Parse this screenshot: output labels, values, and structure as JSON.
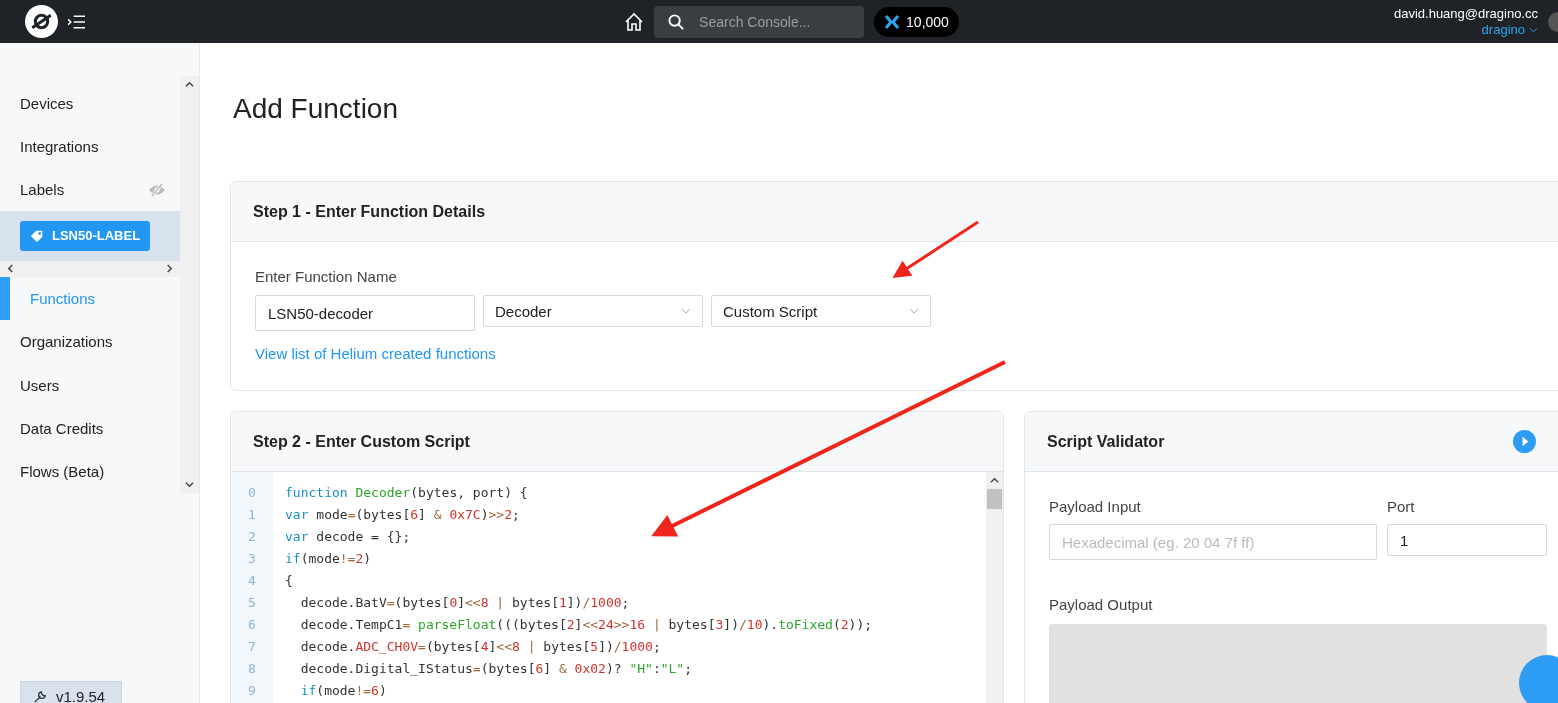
{
  "topbar": {
    "search": {
      "placeholder": "Search Console..."
    },
    "credits": "10,000",
    "user": {
      "email": "david.huang@dragino.cc",
      "org": "dragino"
    }
  },
  "sidebar": {
    "items": [
      {
        "kind": "nav",
        "label": "Devices",
        "selected": false
      },
      {
        "kind": "nav",
        "label": "Integrations",
        "selected": false
      },
      {
        "kind": "nav-hidden",
        "label": "Labels",
        "selected": false
      },
      {
        "kind": "chip",
        "label": "LSN50-LABEL",
        "selected": true
      },
      {
        "kind": "nav",
        "label": "Functions",
        "selected": true
      },
      {
        "kind": "nav",
        "label": "Organizations",
        "selected": false
      },
      {
        "kind": "nav",
        "label": "Users",
        "selected": false
      },
      {
        "kind": "nav",
        "label": "Data Credits",
        "selected": false
      },
      {
        "kind": "nav",
        "label": "Flows (Beta)",
        "selected": false
      }
    ],
    "version": "v1.9.54"
  },
  "page_title": "Add Function",
  "step1": {
    "title": "Step 1 - Enter Function Details",
    "field_label": "Enter Function Name",
    "name_value": "LSN50-decoder",
    "type_select": "Decoder",
    "format_select": "Custom Script",
    "link": "View list of Helium created functions"
  },
  "step2": {
    "title": "Step 2 - Enter Custom Script",
    "code_lines": [
      {
        "number": "0",
        "tokens": [
          {
            "kind": "kw",
            "text": "function"
          },
          {
            "kind": "fn",
            "text": " Decoder"
          },
          {
            "kind": "plain",
            "text": "(bytes, port) {"
          }
        ]
      },
      {
        "number": "1",
        "tokens": [
          {
            "kind": "kw",
            "text": "var"
          },
          {
            "kind": "plain",
            "text": " mode"
          },
          {
            "kind": "op",
            "text": "="
          },
          {
            "kind": "plain",
            "text": "(bytes["
          },
          {
            "kind": "num",
            "text": "6"
          },
          {
            "kind": "plain",
            "text": "] "
          },
          {
            "kind": "op",
            "text": "&"
          },
          {
            "kind": "num",
            "text": " 0x7C"
          },
          {
            "kind": "plain",
            "text": ")"
          },
          {
            "kind": "op",
            "text": ">>"
          },
          {
            "kind": "num",
            "text": "2"
          },
          {
            "kind": "plain",
            "text": ";"
          }
        ]
      },
      {
        "number": "2",
        "tokens": [
          {
            "kind": "kw",
            "text": "var"
          },
          {
            "kind": "plain",
            "text": " decode = {};"
          }
        ]
      },
      {
        "number": "3",
        "tokens": [
          {
            "kind": "kw",
            "text": "if"
          },
          {
            "kind": "plain",
            "text": "(mode"
          },
          {
            "kind": "op",
            "text": "!="
          },
          {
            "kind": "num",
            "text": "2"
          },
          {
            "kind": "plain",
            "text": ")"
          }
        ]
      },
      {
        "number": "4",
        "tokens": [
          {
            "kind": "plain",
            "text": "{"
          }
        ]
      },
      {
        "number": "5",
        "tokens": [
          {
            "kind": "plain",
            "text": "  decode.BatV"
          },
          {
            "kind": "op",
            "text": "="
          },
          {
            "kind": "plain",
            "text": "(bytes["
          },
          {
            "kind": "num",
            "text": "0"
          },
          {
            "kind": "plain",
            "text": "]"
          },
          {
            "kind": "op",
            "text": "<<"
          },
          {
            "kind": "num",
            "text": "8"
          },
          {
            "kind": "op",
            "text": " |"
          },
          {
            "kind": "plain",
            "text": " bytes["
          },
          {
            "kind": "num",
            "text": "1"
          },
          {
            "kind": "plain",
            "text": "])"
          },
          {
            "kind": "op",
            "text": "/"
          },
          {
            "kind": "num",
            "text": "1000"
          },
          {
            "kind": "plain",
            "text": ";"
          }
        ]
      },
      {
        "number": "6",
        "tokens": [
          {
            "kind": "plain",
            "text": "  decode.TempC1"
          },
          {
            "kind": "op",
            "text": "="
          },
          {
            "kind": "fn",
            "text": " parseFloat"
          },
          {
            "kind": "plain",
            "text": "(((bytes["
          },
          {
            "kind": "num",
            "text": "2"
          },
          {
            "kind": "plain",
            "text": "]"
          },
          {
            "kind": "op",
            "text": "<<"
          },
          {
            "kind": "num",
            "text": "24"
          },
          {
            "kind": "op",
            "text": ">>"
          },
          {
            "kind": "num",
            "text": "16"
          },
          {
            "kind": "op",
            "text": " |"
          },
          {
            "kind": "plain",
            "text": " bytes["
          },
          {
            "kind": "num",
            "text": "3"
          },
          {
            "kind": "plain",
            "text": "])"
          },
          {
            "kind": "op",
            "text": "/"
          },
          {
            "kind": "num",
            "text": "10"
          },
          {
            "kind": "plain",
            "text": ")."
          },
          {
            "kind": "fn",
            "text": "toFixed"
          },
          {
            "kind": "plain",
            "text": "("
          },
          {
            "kind": "num",
            "text": "2"
          },
          {
            "kind": "plain",
            "text": "));"
          }
        ]
      },
      {
        "number": "7",
        "tokens": [
          {
            "kind": "plain",
            "text": "  decode."
          },
          {
            "kind": "num",
            "text": "ADC_CH0V"
          },
          {
            "kind": "op",
            "text": "="
          },
          {
            "kind": "plain",
            "text": "(bytes["
          },
          {
            "kind": "num",
            "text": "4"
          },
          {
            "kind": "plain",
            "text": "]"
          },
          {
            "kind": "op",
            "text": "<<"
          },
          {
            "kind": "num",
            "text": "8"
          },
          {
            "kind": "op",
            "text": " |"
          },
          {
            "kind": "plain",
            "text": " bytes["
          },
          {
            "kind": "num",
            "text": "5"
          },
          {
            "kind": "plain",
            "text": "])"
          },
          {
            "kind": "op",
            "text": "/"
          },
          {
            "kind": "num",
            "text": "1000"
          },
          {
            "kind": "plain",
            "text": ";"
          }
        ]
      },
      {
        "number": "8",
        "tokens": [
          {
            "kind": "plain",
            "text": "  decode.Digital_IStatus"
          },
          {
            "kind": "op",
            "text": "="
          },
          {
            "kind": "plain",
            "text": "(bytes["
          },
          {
            "kind": "num",
            "text": "6"
          },
          {
            "kind": "plain",
            "text": "] "
          },
          {
            "kind": "op",
            "text": "&"
          },
          {
            "kind": "num",
            "text": " 0x02"
          },
          {
            "kind": "plain",
            "text": ")? "
          },
          {
            "kind": "fn",
            "text": "\"H\""
          },
          {
            "kind": "plain",
            "text": ":"
          },
          {
            "kind": "fn",
            "text": "\"L\""
          },
          {
            "kind": "plain",
            "text": ";"
          }
        ]
      },
      {
        "number": "9",
        "tokens": [
          {
            "kind": "kw",
            "text": "  if"
          },
          {
            "kind": "plain",
            "text": "(mode"
          },
          {
            "kind": "op",
            "text": "!="
          },
          {
            "kind": "num",
            "text": "6"
          },
          {
            "kind": "plain",
            "text": ")"
          }
        ]
      }
    ]
  },
  "validator": {
    "title": "Script Validator",
    "payload_label": "Payload Input",
    "payload_placeholder": "Hexadecimal (eg. 20 04 7f ff)",
    "port_label": "Port",
    "port_value": "1",
    "output_label": "Payload Output"
  }
}
